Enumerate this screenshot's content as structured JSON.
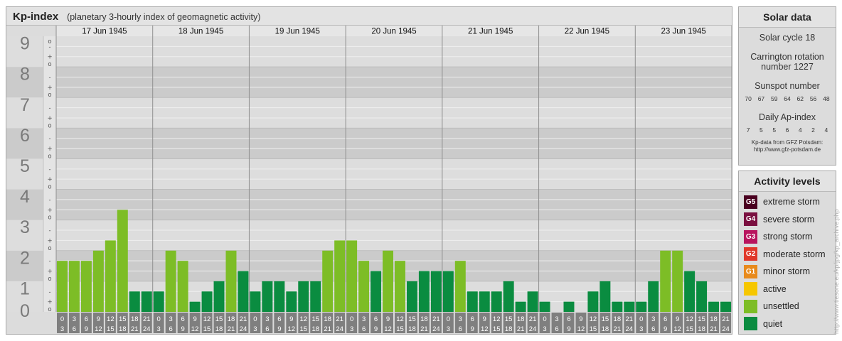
{
  "chart_data": {
    "type": "bar",
    "title": "Kp-index",
    "subtitle": "(planetary 3-hourly index of geomagnetic activity)",
    "ylim": [
      0,
      9
    ],
    "y_ticks": [
      "0",
      "1",
      "2",
      "3",
      "4",
      "5",
      "6",
      "7",
      "8",
      "9"
    ],
    "sub_ticks": [
      "o",
      "+",
      "-"
    ],
    "days": [
      "17 Jun 1945",
      "18 Jun 1945",
      "19 Jun 1945",
      "20 Jun 1945",
      "21 Jun 1945",
      "22 Jun 1945",
      "23 Jun 1945"
    ],
    "interval_start": [
      "0",
      "3",
      "6",
      "9",
      "12",
      "15",
      "18",
      "21"
    ],
    "interval_end": [
      "3",
      "6",
      "9",
      "12",
      "15",
      "18",
      "21",
      "24"
    ],
    "values": [
      1.667,
      1.667,
      1.667,
      2.0,
      2.333,
      3.333,
      0.667,
      0.667,
      0.667,
      2.0,
      1.667,
      0.333,
      0.667,
      1.0,
      2.0,
      1.333,
      0.667,
      1.0,
      1.0,
      0.667,
      1.0,
      1.0,
      2.0,
      2.333,
      2.333,
      1.667,
      1.333,
      2.0,
      1.667,
      1.0,
      1.333,
      1.333,
      1.333,
      1.667,
      0.667,
      0.667,
      0.667,
      1.0,
      0.333,
      0.667,
      0.333,
      0.0,
      0.333,
      0.0,
      0.667,
      1.0,
      0.333,
      0.333,
      0.333,
      1.0,
      2.0,
      2.0,
      1.333,
      1.0,
      0.333,
      0.333
    ],
    "grid": true
  },
  "solar": {
    "title": "Solar data",
    "cycle": "Solar cycle 18",
    "carrington_line1": "Carrington rotation",
    "carrington_line2": "number 1227",
    "sunspot_label": "Sunspot number",
    "sunspots": [
      "70",
      "67",
      "59",
      "64",
      "62",
      "56",
      "48"
    ],
    "ap_label": "Daily Ap-index",
    "ap": [
      "7",
      "5",
      "5",
      "6",
      "4",
      "2",
      "4"
    ],
    "credit_line1": "Kp-data from GFZ Potsdam:",
    "credit_line2": "http://www.gfz-potsdam.de"
  },
  "activity": {
    "title": "Activity levels",
    "levels": [
      {
        "code": "G5",
        "label": "extreme storm",
        "color": "#4a0020"
      },
      {
        "code": "G4",
        "label": "severe storm",
        "color": "#7a1040"
      },
      {
        "code": "G3",
        "label": "strong storm",
        "color": "#b8145e"
      },
      {
        "code": "G2",
        "label": "moderate storm",
        "color": "#e0382a"
      },
      {
        "code": "G1",
        "label": "minor storm",
        "color": "#e88a1c"
      },
      {
        "code": "",
        "label": "active",
        "color": "#f6c700"
      },
      {
        "code": "",
        "label": "unsettled",
        "color": "#7dbd26"
      },
      {
        "code": "",
        "label": "quiet",
        "color": "#0a8c40"
      }
    ]
  },
  "colors": {
    "quiet": "#0a8c40",
    "unsettled": "#7dbd26",
    "active": "#f6c700"
  },
  "watermark": "http://www.tiesone.eu/kp/jpg/kp_archive.php"
}
